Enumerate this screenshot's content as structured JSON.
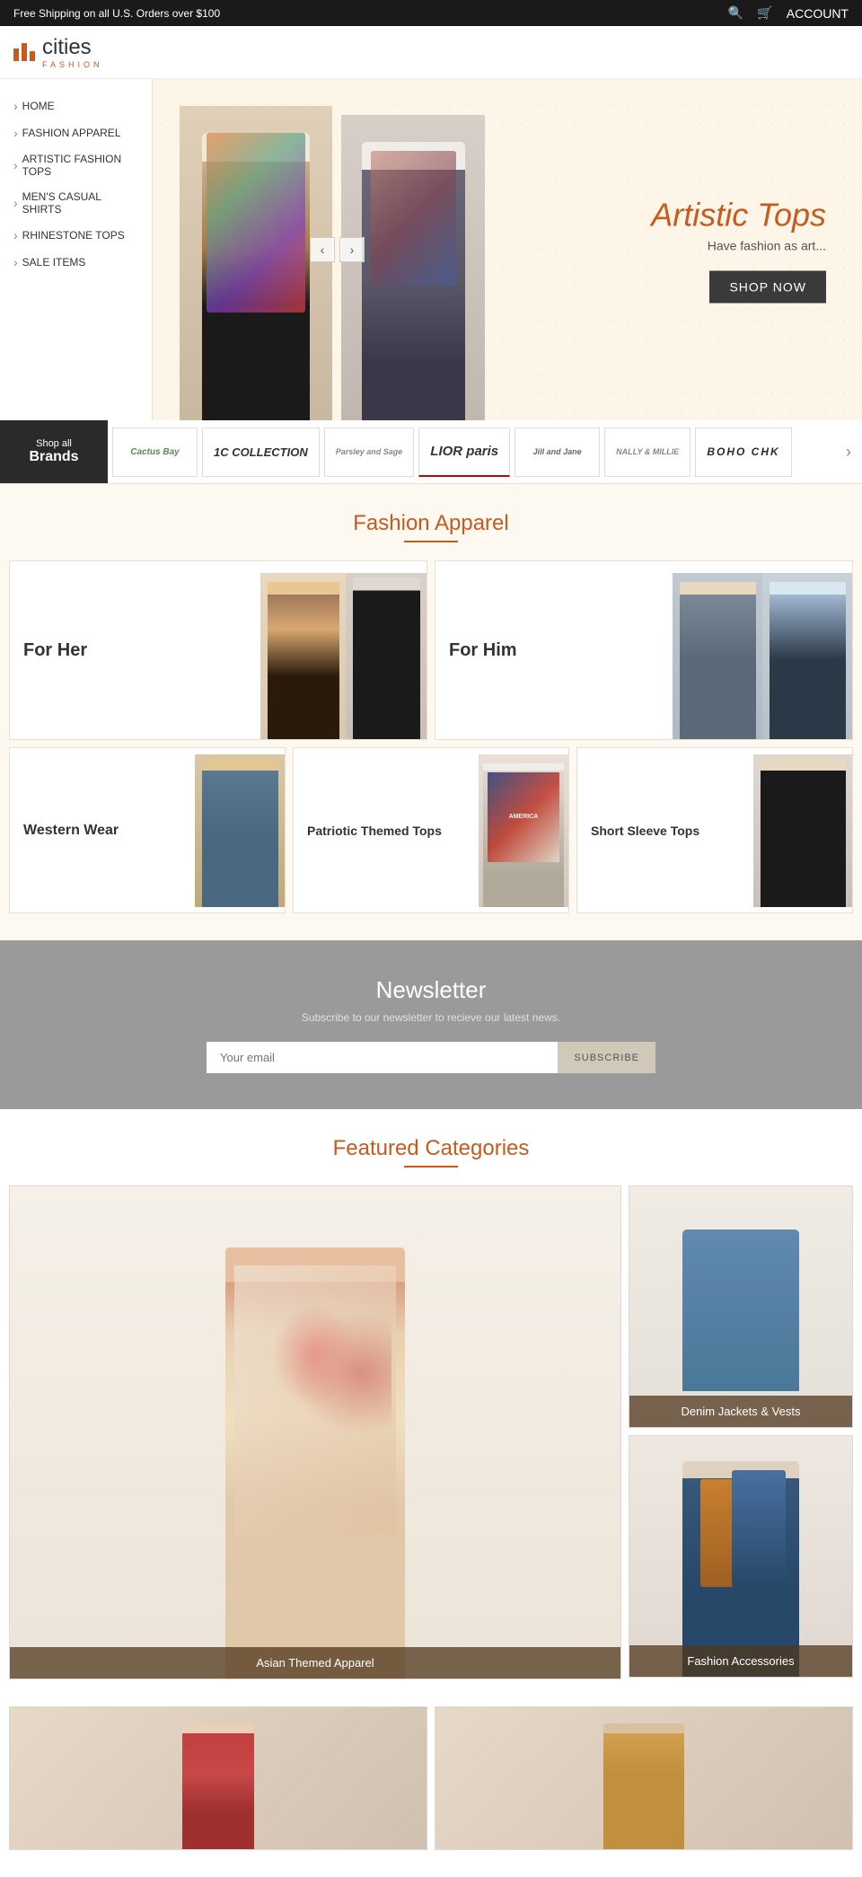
{
  "topbar": {
    "shipping_message": "Free Shipping on all U.S. Orders over $100",
    "account_label": "ACCOUNT"
  },
  "logo": {
    "brand": "cities",
    "sub": "FASHION"
  },
  "nav": {
    "items": [
      {
        "label": "HOME"
      },
      {
        "label": "FASHION APPAREL"
      },
      {
        "label": "ARTISTIC FASHION TOPS"
      },
      {
        "label": "MEN'S CASUAL SHIRTS"
      },
      {
        "label": "RHINESTONE TOPS"
      },
      {
        "label": "SALE ITEMS"
      }
    ]
  },
  "hero": {
    "title": "Artistic Tops",
    "subtitle": "Have fashion as art...",
    "cta": "SHOP NOW",
    "prev": "‹",
    "next": "›"
  },
  "brands": {
    "shop_all": "Shop all",
    "brands_label": "Brands",
    "items": [
      {
        "name": "Cactus Bay",
        "style": "cactus"
      },
      {
        "name": "1C COLLECTION",
        "style": "10c"
      },
      {
        "name": "Parsley and Sage",
        "style": "parsley"
      },
      {
        "name": "LIOR paris",
        "style": "lior"
      },
      {
        "name": "Jill and Jane",
        "style": "jill"
      },
      {
        "name": "NALLY & MILLIE",
        "style": "nally"
      },
      {
        "name": "BOHO CHK",
        "style": "boho"
      }
    ],
    "next": "›"
  },
  "fashion_apparel": {
    "title": "Fashion Apparel",
    "for_her": "For Her",
    "for_him": "For Him",
    "western_wear": "Western Wear",
    "patriotic": "Patriotic Themed Tops",
    "short_sleeve": "Short Sleeve Tops"
  },
  "newsletter": {
    "title": "Newsletter",
    "subtitle": "Subscribe to our newsletter to recieve our latest news.",
    "placeholder": "Your email",
    "button": "SUBSCRIBE"
  },
  "featured": {
    "title": "Featured Categories",
    "asian": "Asian Themed Apparel",
    "denim": "Denim Jackets & Vests",
    "fashion_acc": "Fashion Accessories"
  }
}
